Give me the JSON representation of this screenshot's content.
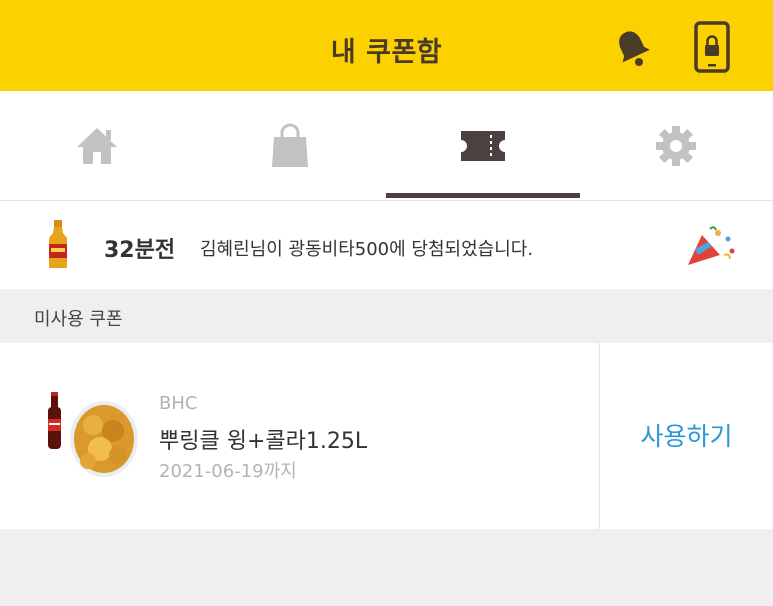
{
  "header": {
    "title": "내 쿠폰함",
    "bell_icon": "bell-icon",
    "phone_icon": "phone-lock-icon",
    "accent_color": "#fcd100"
  },
  "tabs": [
    {
      "name": "home",
      "icon": "home-icon",
      "active": false
    },
    {
      "name": "shop",
      "icon": "shopping-bag-icon",
      "active": false
    },
    {
      "name": "coupon",
      "icon": "ticket-icon",
      "active": true
    },
    {
      "name": "settings",
      "icon": "gear-icon",
      "active": false
    }
  ],
  "notice": {
    "time": "32분전",
    "message": "김혜린님이 광동비타500에 당첨되었습니다.",
    "icon_left": "vita500-bottle",
    "icon_right": "party-popper-icon"
  },
  "section": {
    "title": "미사용 쿠폰"
  },
  "coupons": [
    {
      "brand": "BHC",
      "name": "뿌링클 윙+콜라1.25L",
      "expiry": "2021-06-19까지",
      "action": "사용하기",
      "image": "chicken-and-cola"
    }
  ],
  "colors": {
    "action_blue": "#2a97d6",
    "muted_text": "#b3b3b3",
    "tab_inactive": "#c2c2c2",
    "tab_active": "#4b4240"
  }
}
